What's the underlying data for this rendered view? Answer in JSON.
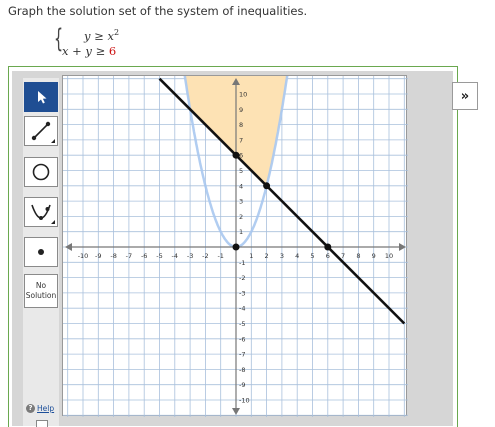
{
  "prompt": "Graph the solution set of the system of inequalities.",
  "system": {
    "brace": "{",
    "ineq1": {
      "lhs": "y ≥ x",
      "exponent": "2"
    },
    "ineq2": {
      "lhs": "x + y ≥ ",
      "rhs": "6"
    }
  },
  "toolbar": {
    "tools": [
      {
        "name": "select",
        "icon": "arrow-pointer-icon",
        "active": true
      },
      {
        "name": "line",
        "icon": "line-segment-icon",
        "active": false
      },
      {
        "name": "circle",
        "icon": "circle-icon",
        "active": false
      },
      {
        "name": "parabola",
        "icon": "parabola-icon",
        "active": false
      },
      {
        "name": "point",
        "icon": "point-icon",
        "active": false
      }
    ],
    "no_solution_line1": "No",
    "no_solution_line2": "Solution",
    "help_label": "Help",
    "help_icon": "?"
  },
  "expand_label": "»",
  "colors": {
    "shade": "#fde2b4",
    "parabola": "#a8c8f0",
    "line": "#111111",
    "grid": "#a9c0dc",
    "axis": "#777777",
    "active_tool": "#1f4e93",
    "red_value": "#cc1111"
  },
  "chart_data": {
    "type": "inequality-graph",
    "xlim": [
      -10,
      10
    ],
    "ylim": [
      -10,
      10
    ],
    "x_ticks": [
      -10,
      -9,
      -8,
      -7,
      -6,
      -5,
      -4,
      -3,
      -2,
      -1,
      1,
      2,
      3,
      4,
      5,
      6,
      7,
      8,
      9,
      10
    ],
    "y_ticks": [
      10,
      9,
      8,
      7,
      6,
      5,
      4,
      3,
      2,
      1,
      -1,
      -2,
      -3,
      -4,
      -5,
      -6,
      -7,
      -8,
      -9,
      -10
    ],
    "grid": true,
    "parabola": {
      "a": 1,
      "h": 0,
      "k": 0,
      "style": "faint"
    },
    "line": {
      "slope": -1,
      "intercept": 6,
      "style": "solid"
    },
    "shaded_region": "y >= x^2 and x + y >= 6",
    "points": [
      {
        "x": 0,
        "y": 0
      },
      {
        "x": 0,
        "y": 6
      },
      {
        "x": 2,
        "y": 4
      },
      {
        "x": 6,
        "y": 0
      }
    ]
  }
}
